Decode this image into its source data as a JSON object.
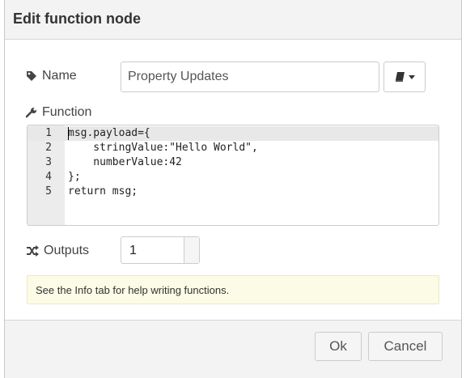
{
  "dialog": {
    "title": "Edit function node"
  },
  "name_row": {
    "label": "Name",
    "label_icon": "tag-icon",
    "value": "Property Updates",
    "library_icon": "book-icon"
  },
  "function_row": {
    "label": "Function",
    "label_icon": "wrench-icon",
    "lines": [
      {
        "num": "1",
        "code": "msg.payload={"
      },
      {
        "num": "2",
        "code": "    stringValue:\"Hello World\","
      },
      {
        "num": "3",
        "code": "    numberValue:42"
      },
      {
        "num": "4",
        "code": "};"
      },
      {
        "num": "5",
        "code": "return msg;"
      }
    ]
  },
  "outputs_row": {
    "label": "Outputs",
    "label_icon": "random-icon",
    "value": "1"
  },
  "tip": {
    "text": "See the Info tab for help writing functions."
  },
  "footer": {
    "ok_label": "Ok",
    "cancel_label": "Cancel"
  },
  "colors": {
    "tip_background": "#fcfbe6",
    "gutter_background": "#ececec",
    "titlebar_background": "#f3f3f3"
  }
}
